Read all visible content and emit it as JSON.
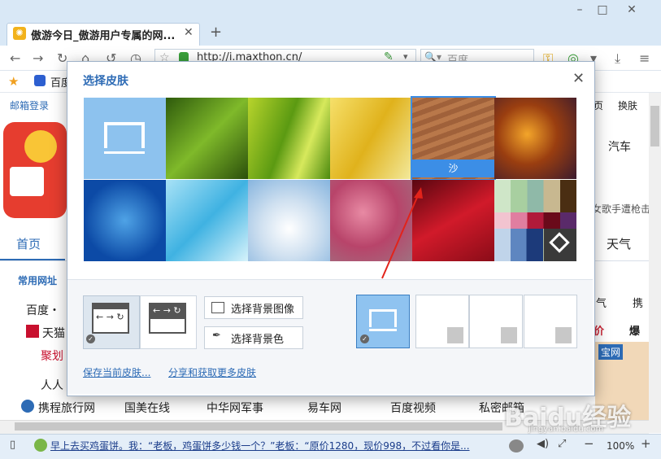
{
  "browser": {
    "tab_title": "傲游今日_傲游用户专属的网...",
    "url": "http://i.maxthon.cn/",
    "search_placeholder": "百度",
    "fav_baidu": "百度",
    "status_text": "早上去买鸡蛋饼。我：“老板，鸡蛋饼多少钱一个？”老板：“原价1280，现价998，不过看你是...",
    "zoom": "100%",
    "watermark": "Baidu经验",
    "watermark_sub": "jingyan.baidu.com"
  },
  "page": {
    "mail": "邮箱登录",
    "nav_home": "首页",
    "common_sites": "常用网址",
    "sites": [
      "百度・",
      "天猫",
      "聚划",
      "人人",
      "携程旅行网",
      "国美在线",
      "中华网军事",
      "易车网",
      "百度视频",
      "私密邮箱"
    ],
    "right_page": "页",
    "right_skin": "换肤",
    "right_car": "汽车",
    "right_news": "女歌手遭枪击",
    "right_weather": "天气",
    "right_qi": "气",
    "right_xie": "携",
    "right_price": "价",
    "right_burst": "爆",
    "right_banner": "宝网"
  },
  "dialog": {
    "title": "选择皮肤",
    "selected_skin_label": "沙",
    "btn_select_image": "选择背景图像",
    "btn_select_color": "选择背景色",
    "link_save": "保存当前皮肤...",
    "link_share": "分享和获取更多皮肤"
  },
  "colors": {
    "accent": "#2d6bb5",
    "selection": "#3c8ee6"
  }
}
